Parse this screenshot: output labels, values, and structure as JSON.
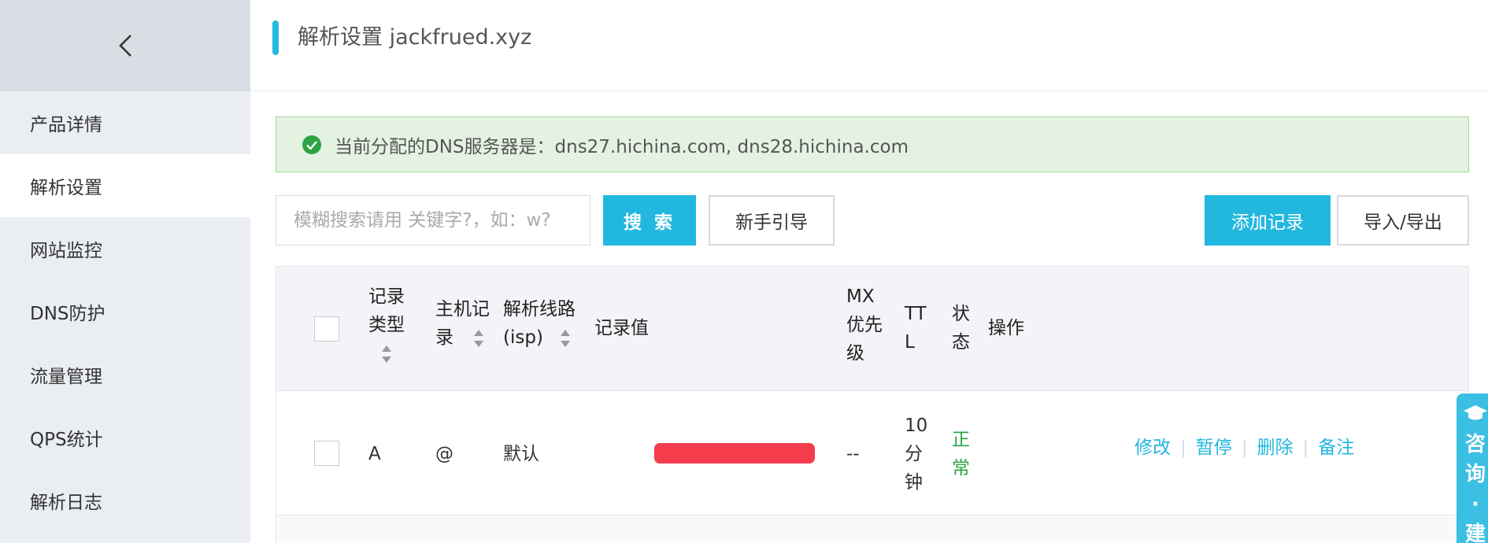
{
  "header": {
    "title": "解析设置 jackfrued.xyz"
  },
  "sidebar": {
    "items": [
      {
        "label": "产品详情"
      },
      {
        "label": "解析设置"
      },
      {
        "label": "网站监控"
      },
      {
        "label": "DNS防护"
      },
      {
        "label": "流量管理"
      },
      {
        "label": "QPS统计"
      },
      {
        "label": "解析日志"
      }
    ]
  },
  "notice": {
    "text": "当前分配的DNS服务器是：dns27.hichina.com, dns28.hichina.com"
  },
  "toolbar": {
    "search_placeholder": "模糊搜索请用 关键字?，如：w?",
    "search_label": "搜 索",
    "guide_label": "新手引导",
    "add_label": "添加记录",
    "import_label": "导入/导出"
  },
  "table": {
    "headers": {
      "type_l1": "记录",
      "type_l2": "类型",
      "host_l1": "主机记",
      "host_l2": "录",
      "line_l1": "解析线路",
      "line_l2": "(isp)",
      "value": "记录值",
      "mx_l1": "MX",
      "mx_l2": "优先",
      "mx_l3": "级",
      "ttl_l1": "TT",
      "ttl_l2": "L",
      "status_l1": "状",
      "status_l2": "态",
      "ops": "操作"
    },
    "rows": [
      {
        "type": "A",
        "host": "@",
        "line": "默认",
        "mx": "--",
        "ttl_l1": "10",
        "ttl_l2": "分",
        "ttl_l3": "钟",
        "status_l1": "正",
        "status_l2": "常",
        "ops": [
          "修改",
          "暂停",
          "删除",
          "备注"
        ]
      }
    ]
  },
  "consult": {
    "chars": [
      "咨",
      "询",
      "·",
      "建"
    ]
  },
  "colors": {
    "accent": "#22b7df",
    "success": "#2aa442",
    "masked": "#f53c4c"
  }
}
